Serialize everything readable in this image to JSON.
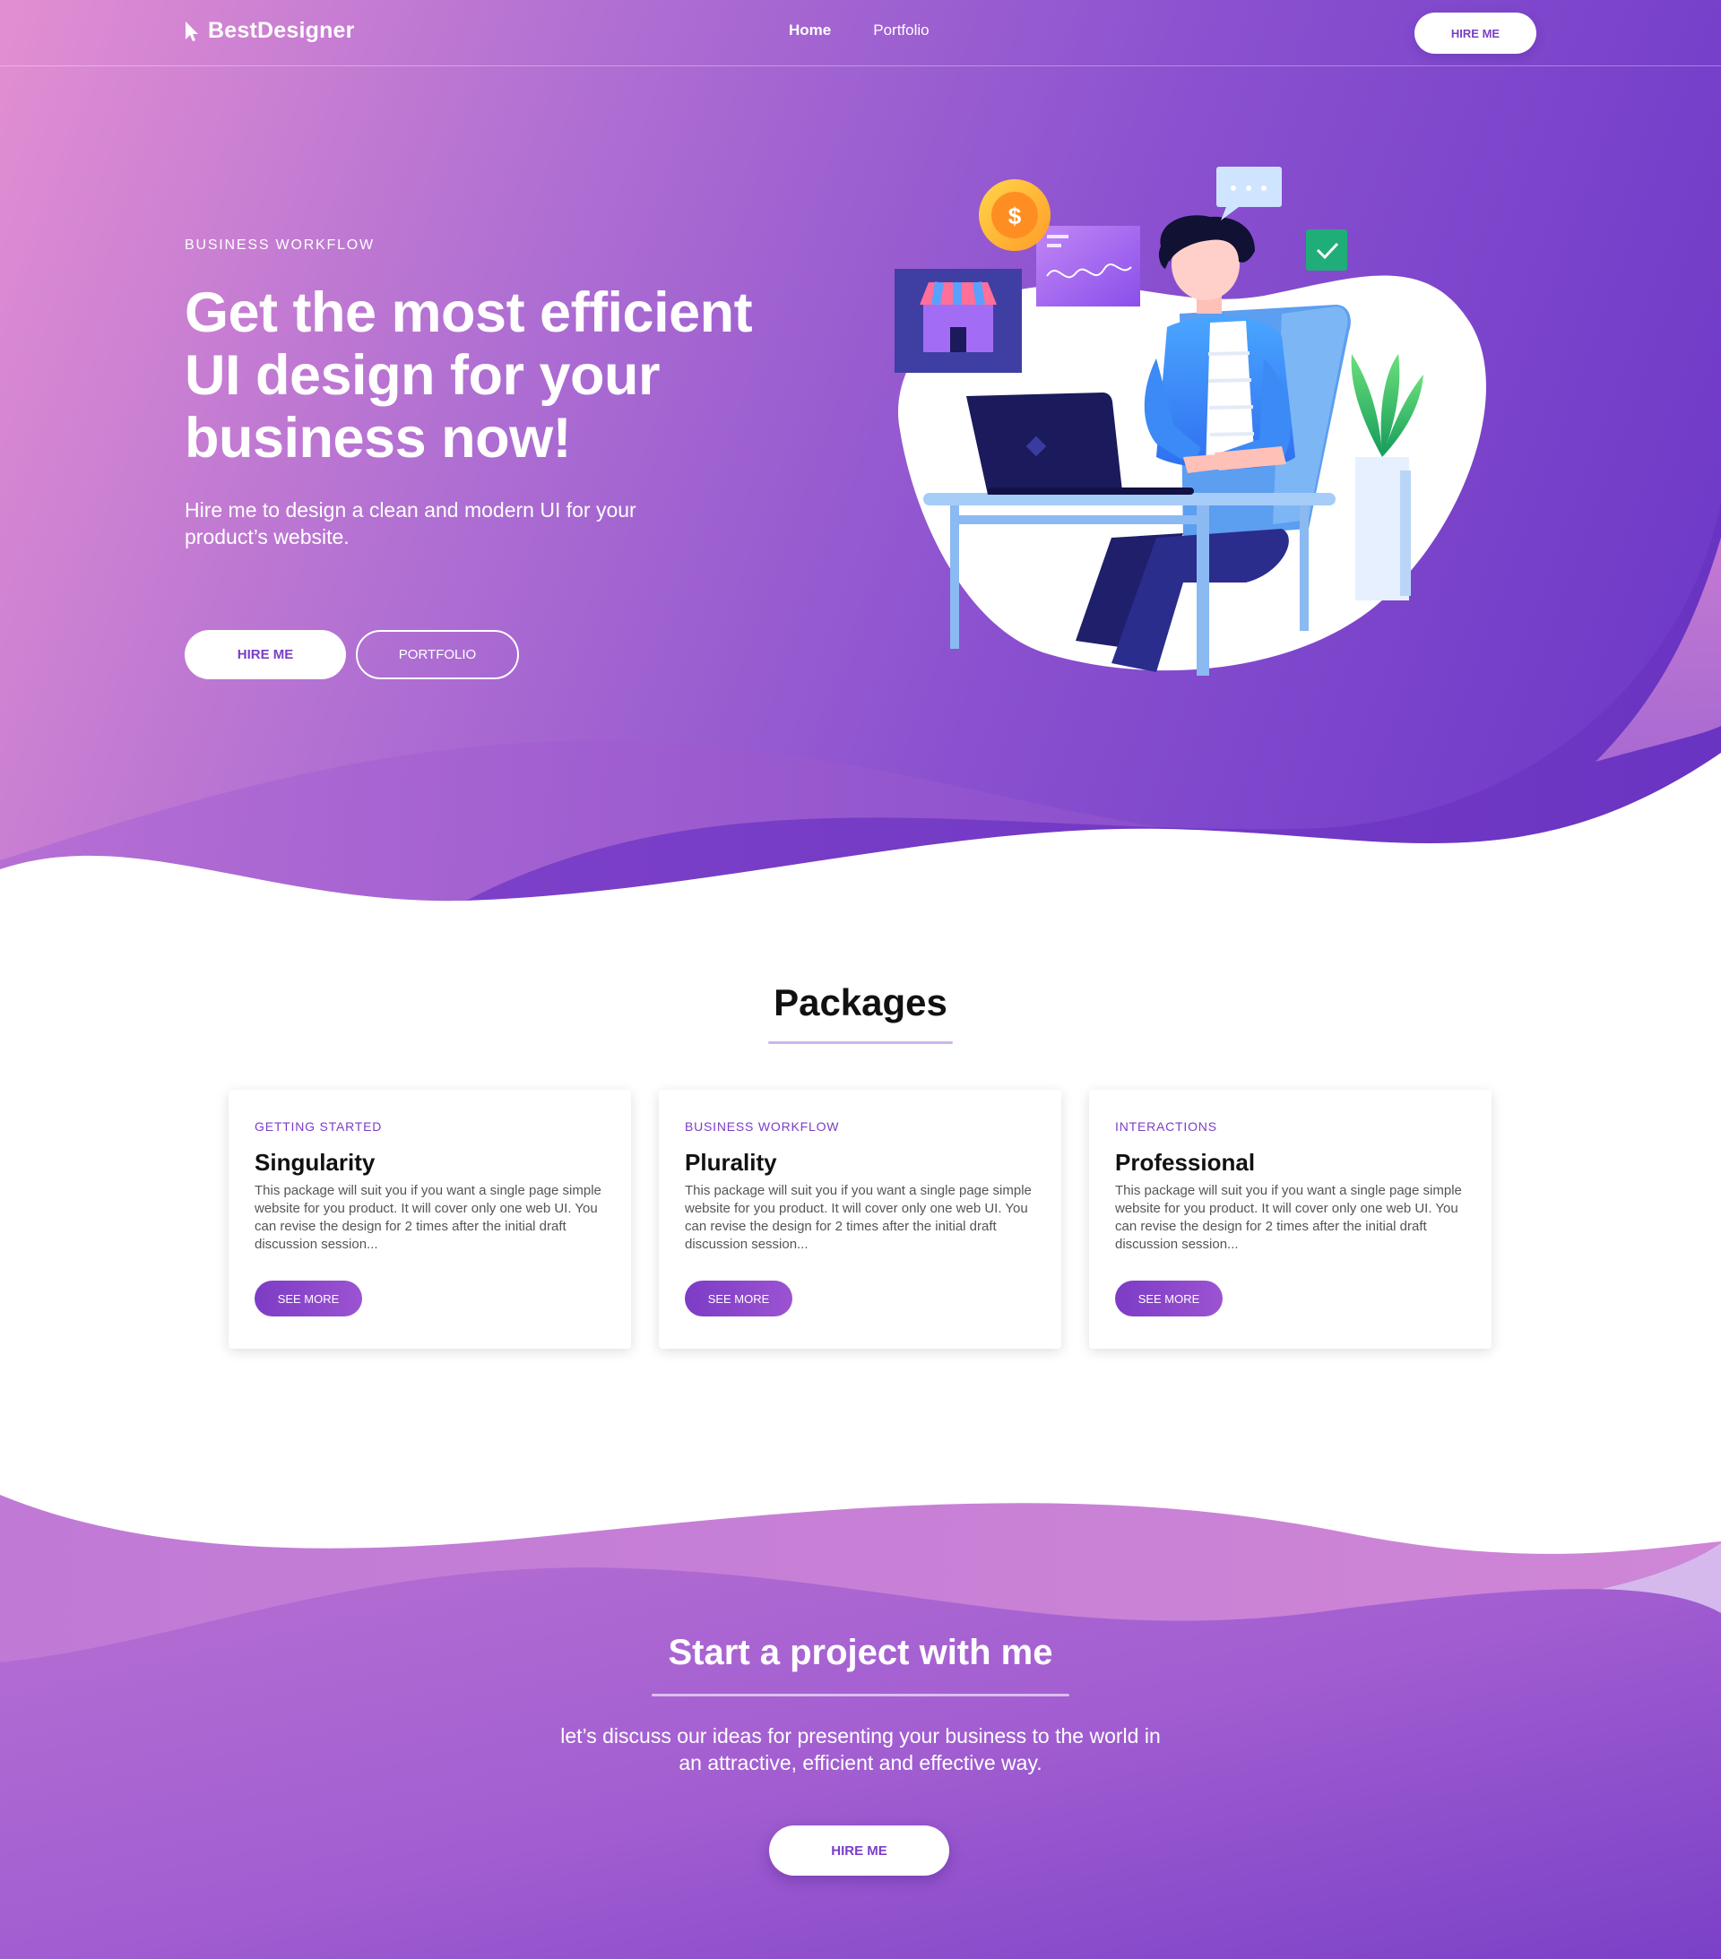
{
  "nav": {
    "brand": "BestDesigner",
    "brand_icon": "cursor-arrow-icon",
    "links": [
      {
        "label": "Home",
        "active": true
      },
      {
        "label": "Portfolio",
        "active": false
      }
    ],
    "cta_label": "HIRE ME"
  },
  "hero": {
    "eyebrow": "BUSINESS WORKFLOW",
    "title": "Get the most efficient UI design for your business now!",
    "subtitle": "Hire me to design a clean and modern UI for your product’s website.",
    "primary_button": "HIRE ME",
    "secondary_button": "PORTFOLIO",
    "illustration": "designer-at-desk-illustration",
    "icons": [
      "coin-icon",
      "store-icon",
      "chart-card-icon",
      "chat-bubble-icon",
      "checkmark-icon",
      "plant-icon"
    ]
  },
  "packages": {
    "title": "Packages",
    "cards": [
      {
        "eyebrow": "GETTING STARTED",
        "title": "Singularity",
        "description": "This package will suit you if you want a single page simple website for you product. It  will cover only one web UI.  You can  revise the design for 2 times  after the initial draft  discussion session...",
        "button": "SEE MORE"
      },
      {
        "eyebrow": "BUSINESS WORKFLOW",
        "title": "Plurality",
        "description": "This package will suit you if you want a single page simple website for you product. It  will cover only one web UI.  You can  revise the design for 2 times  after the initial draft  discussion session...",
        "button": "SEE MORE"
      },
      {
        "eyebrow": "INTERACTIONS",
        "title": "Professional",
        "description": "This package will suit you if you want a single page simple website for you product. It  will cover only one web UI.  You can  revise the design for 2 times  after the initial draft  discussion session...",
        "button": "SEE MORE"
      }
    ]
  },
  "cta": {
    "title": "Start a project with me",
    "subtitle": "let’s discuss our ideas for presenting your business to the world in an attractive,  efficient and effective way.",
    "button": "HIRE ME"
  },
  "colors": {
    "accent": "#7a3fc8",
    "gradient_start": "#e38fd2",
    "gradient_end": "#6a36c6"
  }
}
